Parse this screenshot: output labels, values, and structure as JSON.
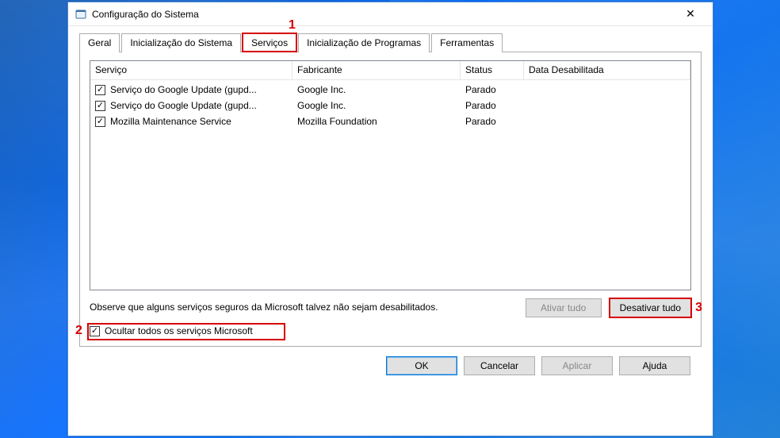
{
  "window": {
    "title": "Configuração do Sistema",
    "close_glyph": "✕"
  },
  "tabs": [
    {
      "label": "Geral"
    },
    {
      "label": "Inicialização do Sistema"
    },
    {
      "label": "Serviços",
      "active": true
    },
    {
      "label": "Inicialização de Programas"
    },
    {
      "label": "Ferramentas"
    }
  ],
  "columns": {
    "service": "Serviço",
    "vendor": "Fabricante",
    "status": "Status",
    "date": "Data Desabilitada"
  },
  "rows": [
    {
      "checked": true,
      "service": "Serviço do Google Update (gupd...",
      "vendor": "Google Inc.",
      "status": "Parado",
      "date": ""
    },
    {
      "checked": true,
      "service": "Serviço do Google Update (gupd...",
      "vendor": "Google Inc.",
      "status": "Parado",
      "date": ""
    },
    {
      "checked": true,
      "service": "Mozilla Maintenance Service",
      "vendor": "Mozilla Foundation",
      "status": "Parado",
      "date": ""
    }
  ],
  "note": "Observe que alguns serviços seguros da Microsoft talvez não sejam desabilitados.",
  "buttons": {
    "enable_all": "Ativar tudo",
    "disable_all": "Desativar tudo"
  },
  "hide_ms": {
    "checked": true,
    "label": "Ocultar todos os serviços Microsoft"
  },
  "footer": {
    "ok": "OK",
    "cancel": "Cancelar",
    "apply": "Aplicar",
    "help": "Ajuda"
  },
  "annotations": {
    "step1": "1",
    "step2": "2",
    "step3": "3"
  }
}
